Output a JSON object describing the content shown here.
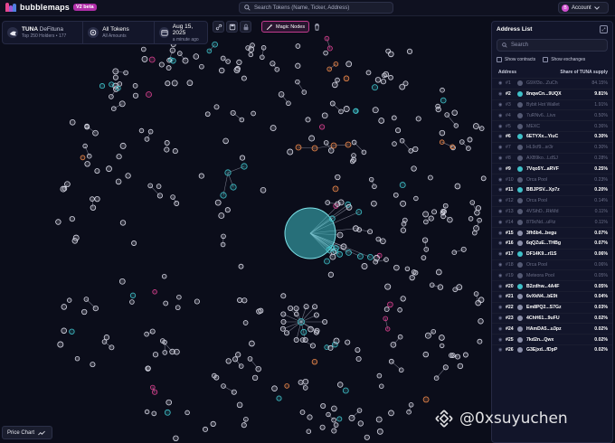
{
  "app": {
    "logo_text": "bubblemaps",
    "version_badge": "V2 beta",
    "search_placeholder": "Search Tokens (Name, Ticker, Address)",
    "account_label": "Account",
    "account_initial": "B"
  },
  "token": {
    "ticker": "TUNA",
    "name": "DeFituna",
    "holders_sub": "Top 250 Holders • 177",
    "tokens_title": "All Tokens",
    "tokens_sub": "All Amounts",
    "date_title": "Aug 15, 2025",
    "date_sub": "a minute ago"
  },
  "toolbar": {
    "magic_label": "Magic Nodes"
  },
  "address_list": {
    "title": "Address List",
    "search_placeholder": "Search",
    "show_contracts": "Show contracts",
    "show_exchanges": "Show exchanges",
    "col_address": "Address",
    "col_share": "Share of TUNA supply",
    "rows": [
      {
        "rank": "#1",
        "name": "G9Xf3o...ZuCh",
        "pct": "84.15%",
        "style": "dim",
        "color": "#555a74"
      },
      {
        "rank": "#2",
        "name": "8nqwCn...9UQX",
        "pct": "9.81%",
        "style": "hi",
        "color": "#3fc1c9"
      },
      {
        "rank": "#3",
        "name": "Bybit Hot Wallet",
        "pct": "1.91%",
        "style": "dim",
        "color": "#555a74"
      },
      {
        "rank": "#4",
        "name": "7uRNv6...Livx",
        "pct": "0.50%",
        "style": "dim",
        "color": "#555a74"
      },
      {
        "rank": "#5",
        "name": "MEXC",
        "pct": "0.36%",
        "style": "dim",
        "color": "#555a74"
      },
      {
        "rank": "#6",
        "name": "6ETYXx...YiuC",
        "pct": "0.30%",
        "style": "hi",
        "color": "#3fc1c9"
      },
      {
        "rank": "#7",
        "name": "HL9cf9...sr3r",
        "pct": "0.30%",
        "style": "dim",
        "color": "#555a74"
      },
      {
        "rank": "#8",
        "name": "AXB9ko...LdSJ",
        "pct": "0.28%",
        "style": "dim",
        "color": "#555a74"
      },
      {
        "rank": "#9",
        "name": "7Vqo5Y...aRVF",
        "pct": "0.25%",
        "style": "hi",
        "color": "#3fc1c9"
      },
      {
        "rank": "#10",
        "name": "Orca Pool",
        "pct": "0.23%",
        "style": "dim",
        "color": "#555a74"
      },
      {
        "rank": "#11",
        "name": "BBJPSV...Xp7z",
        "pct": "0.20%",
        "style": "hi",
        "color": "#3fc1c9"
      },
      {
        "rank": "#12",
        "name": "Orca Pool",
        "pct": "0.14%",
        "style": "dim",
        "color": "#555a74"
      },
      {
        "rank": "#13",
        "name": "4VSihD...RkMd",
        "pct": "0.11%",
        "style": "dim",
        "color": "#555a74"
      },
      {
        "rank": "#14",
        "name": "879cNd...uFtz",
        "pct": "0.11%",
        "style": "dim",
        "color": "#555a74"
      },
      {
        "rank": "#15",
        "name": "3fh5b4...begu",
        "pct": "0.07%",
        "style": "hi",
        "color": "#8c90aa"
      },
      {
        "rank": "#16",
        "name": "6qQZuE...THBg",
        "pct": "0.07%",
        "style": "hi",
        "color": "#8c90aa"
      },
      {
        "rank": "#17",
        "name": "DF14K9...rI1S",
        "pct": "0.06%",
        "style": "hi",
        "color": "#3fc1c9"
      },
      {
        "rank": "#18",
        "name": "Orca Pool",
        "pct": "0.06%",
        "style": "dim",
        "color": "#555a74"
      },
      {
        "rank": "#19",
        "name": "Meteora Pool",
        "pct": "0.05%",
        "style": "dim",
        "color": "#555a74"
      },
      {
        "rank": "#20",
        "name": "B2zdhw...4A4F",
        "pct": "0.05%",
        "style": "hi",
        "color": "#3fc1c9"
      },
      {
        "rank": "#21",
        "name": "6vXkN4...bE9t",
        "pct": "0.04%",
        "style": "hi",
        "color": "#8c90aa"
      },
      {
        "rank": "#22",
        "name": "Em8PQ2...S7Gz",
        "pct": "0.03%",
        "style": "hi",
        "color": "#8c90aa"
      },
      {
        "rank": "#23",
        "name": "4ChH61...9uFU",
        "pct": "0.02%",
        "style": "hi",
        "color": "#8c90aa"
      },
      {
        "rank": "#24",
        "name": "HAmDA5...u3pz",
        "pct": "0.02%",
        "style": "hi",
        "color": "#8c90aa"
      },
      {
        "rank": "#25",
        "name": "7kd2n...Qwx",
        "pct": "0.02%",
        "style": "hi",
        "color": "#8c90aa"
      },
      {
        "rank": "#26",
        "name": "G3Ejxd...fDpP",
        "pct": "0.02%",
        "style": "hi",
        "color": "#8c90aa"
      }
    ]
  },
  "bottom": {
    "price_chart_label": "Price Chart",
    "watermark_text": "@0xsuyuchen"
  },
  "colors": {
    "background": "#0b0d1a",
    "accent_teal": "#3fc1c9",
    "accent_pink": "#d8418f",
    "accent_orange": "#f08a4b",
    "node_default": "#d8d9e6"
  }
}
